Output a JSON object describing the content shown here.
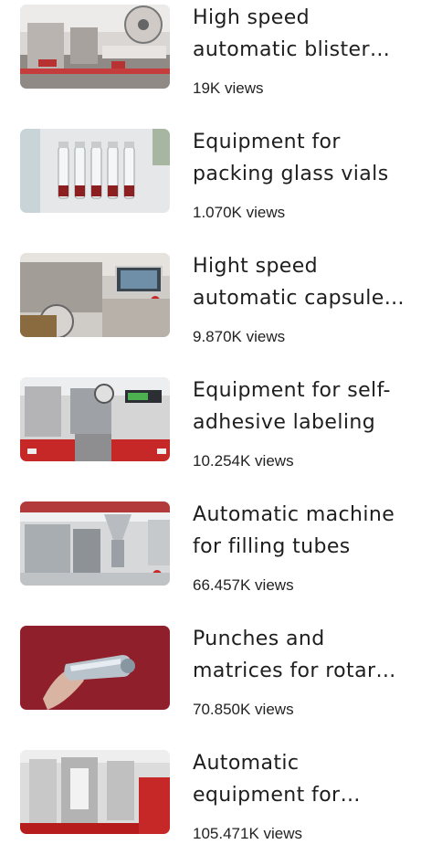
{
  "videos": [
    {
      "title": "High speed automatic blister packing machine",
      "views": "19K views"
    },
    {
      "title": "Equipment for packing glass vials",
      "views": "1.070K views"
    },
    {
      "title": "Hight speed automatic capsule filling",
      "views": "9.870K views"
    },
    {
      "title": "Equipment for self-adhesive labeling",
      "views": "10.254K views"
    },
    {
      "title": "Automatic machine for filling tubes",
      "views": "66.457K views"
    },
    {
      "title": "Punches and matrices for rotary presses",
      "views": "70.850K views"
    },
    {
      "title": "Automatic equipment for packing sachets",
      "views": "105.471K views"
    }
  ],
  "colors": {
    "title": "#1e1e1e",
    "views": "#222222",
    "background": "#ffffff"
  }
}
